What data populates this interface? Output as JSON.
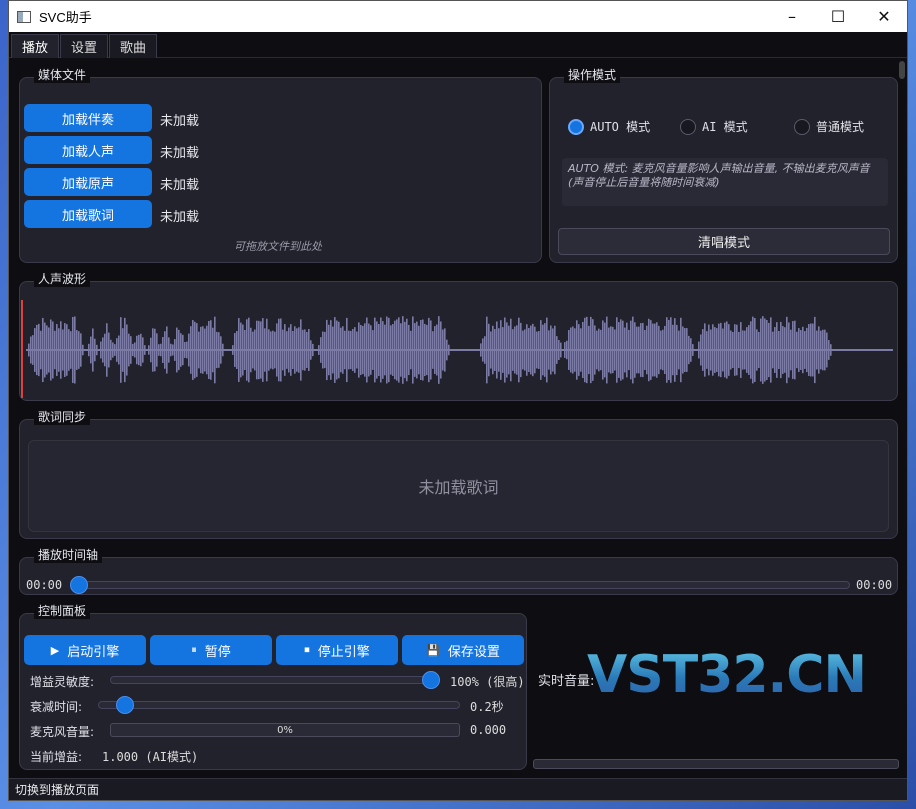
{
  "window": {
    "title": "SVC助手"
  },
  "tabs": [
    {
      "label": "播放",
      "active": true
    },
    {
      "label": "设置",
      "active": false
    },
    {
      "label": "歌曲",
      "active": false
    }
  ],
  "media": {
    "title": "媒体文件",
    "buttons": [
      {
        "label": "加载伴奏",
        "status": "未加载"
      },
      {
        "label": "加载人声",
        "status": "未加载"
      },
      {
        "label": "加载原声",
        "status": "未加载"
      },
      {
        "label": "加载歌词",
        "status": "未加载"
      }
    ],
    "drop_hint": "可拖放文件到此处"
  },
  "mode": {
    "title": "操作模式",
    "options": [
      {
        "label": "AUTO 模式",
        "selected": true
      },
      {
        "label": "AI 模式",
        "selected": false
      },
      {
        "label": "普通模式",
        "selected": false
      }
    ],
    "description": "AUTO 模式: 麦克风音量影响人声输出音量, 不输出麦克风声音\n(声音停止后音量将随时间衰减)",
    "acapella_button": "清唱模式"
  },
  "waveform": {
    "title": "人声波形",
    "color": "#7b7ba6",
    "playhead_color": "#e04040"
  },
  "lyrics": {
    "title": "歌词同步",
    "placeholder": "未加载歌词"
  },
  "timeline": {
    "title": "播放时间轴",
    "current": "00:00",
    "total": "00:00",
    "progress": 0
  },
  "control": {
    "title": "控制面板",
    "buttons": [
      {
        "label": "启动引擎",
        "icon": "play-icon"
      },
      {
        "label": "暂停",
        "icon": "pause-icon"
      },
      {
        "label": "停止引擎",
        "icon": "stop-icon"
      },
      {
        "label": "保存设置",
        "icon": "save-icon"
      }
    ],
    "gain_sensitivity": {
      "label": "增益灵敏度:",
      "value": "100% (很高)",
      "level": 1.0
    },
    "decay_time": {
      "label": "衰减时间:",
      "value": "0.2秒",
      "level": 0.0
    },
    "mic_volume": {
      "label": "麦克风音量:",
      "progress_text": "0%",
      "value": "0.000"
    },
    "current_gain": {
      "label": "当前增益:",
      "value": "1.000 (AI模式)"
    }
  },
  "realtime_volume": {
    "label": "实时音量:"
  },
  "watermark": "VST32.CN",
  "status_bar": "切换到播放页面",
  "colors": {
    "accent": "#1474e0",
    "background": "#0d0d12",
    "panel": "#22222d"
  }
}
